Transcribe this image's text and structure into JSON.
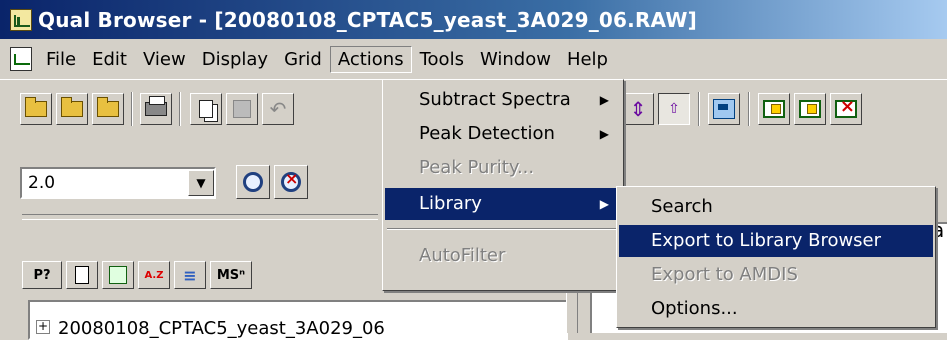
{
  "window": {
    "title": "Qual Browser - [20080108_CPTAC5_yeast_3A029_06.RAW]"
  },
  "menubar": {
    "items": [
      "File",
      "Edit",
      "View",
      "Display",
      "Grid",
      "Actions",
      "Tools",
      "Window",
      "Help"
    ],
    "open": "Actions"
  },
  "actions_menu": {
    "items": [
      {
        "label": "Subtract Spectra",
        "submenu": true,
        "enabled": true
      },
      {
        "label": "Peak Detection",
        "submenu": true,
        "enabled": true
      },
      {
        "label": "Peak Purity...",
        "submenu": false,
        "enabled": false
      },
      {
        "label": "Library",
        "submenu": true,
        "enabled": true,
        "selected": true
      },
      {
        "label": "AutoFilter",
        "submenu": false,
        "enabled": false
      }
    ]
  },
  "library_submenu": {
    "items": [
      {
        "label": "Search",
        "enabled": true
      },
      {
        "label": "Export to Library Browser",
        "enabled": true,
        "selected": true
      },
      {
        "label": "Export to AMDIS",
        "enabled": false
      },
      {
        "label": "Options...",
        "enabled": true
      }
    ]
  },
  "combo": {
    "value": "2.0"
  },
  "tree": {
    "plus": "+",
    "item": "20080108_CPTAC5_yeast_3A029_06"
  },
  "small_tabs": [
    "P?",
    "",
    "",
    "A.Z",
    "",
    "MSⁿ"
  ],
  "right_pane_fragment": "a",
  "colors": {
    "highlight": "#0a246a",
    "face": "#d4d0c8",
    "title_start": "#0a246a",
    "title_end": "#a6caf0"
  }
}
